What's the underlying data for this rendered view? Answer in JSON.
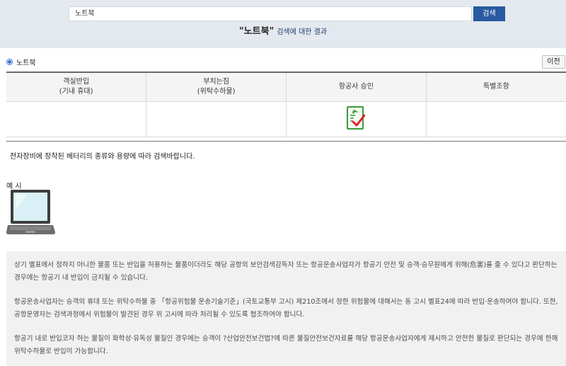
{
  "search": {
    "value": "노트북",
    "button_label": "검색"
  },
  "result": {
    "keyword": "\"노트북\"",
    "suffix": "검색에 대한 결과"
  },
  "category": {
    "label": "노트북"
  },
  "prev_label": "이전",
  "table": {
    "columns": [
      {
        "line1": "객실반입",
        "line2": "(기내 휴대)"
      },
      {
        "line1": "부치는짐",
        "line2": "(위탁수하물)"
      },
      {
        "line1": "항공사 승인",
        "line2": ""
      },
      {
        "line1": "특별조항",
        "line2": ""
      }
    ],
    "approval_icon": "airline-approval-check-icon"
  },
  "guide_text": "전자장비에 장착된 베터리의 종류와 용량에 따라 검색바랍니다.",
  "example_label": "예 시",
  "notices": [
    "상기 별표에서 정하지 아니한 물품 또는 반입을 허용하는 물품이더라도 해당 공항의 보안검색감독자 또는 항공운송사업자가 항공기 안전 및 승객·승무원에게 위해(危害)를 줄 수 있다고 판단하는 경우에는 항공기 내 반입이 금지될 수 있습니다.",
    "항공운송사업자는 승객의 휴대 또는 위탁수하물 중 「항공위험물 운송기술기준」(국토교통부 고시) 제210조에서 정한 위험물에 대해서는 동 고시 별표24에 따라 반입·운송하여야 합니다. 또한, 공항운영자는 검색과정에서 위험물이 발견된 경우 위 고시에 따라 처리될 수 있도록 협조하여야 합니다.",
    "항공기 내로 반입코자 하는 물질이 화학성·유독성 물질인 경우에는 승객이 ?산업안전보건법?에 따른 물질안전보건자료를 해당 항공운송사업자에게 제시하고 안전한 물질로 판단되는 경우에 한해 위탁수하물로 반입이 가능합니다."
  ],
  "colors": {
    "band": "#e4e9ef",
    "accent": "#275aa0",
    "notice_bg": "#f1f1f1"
  }
}
